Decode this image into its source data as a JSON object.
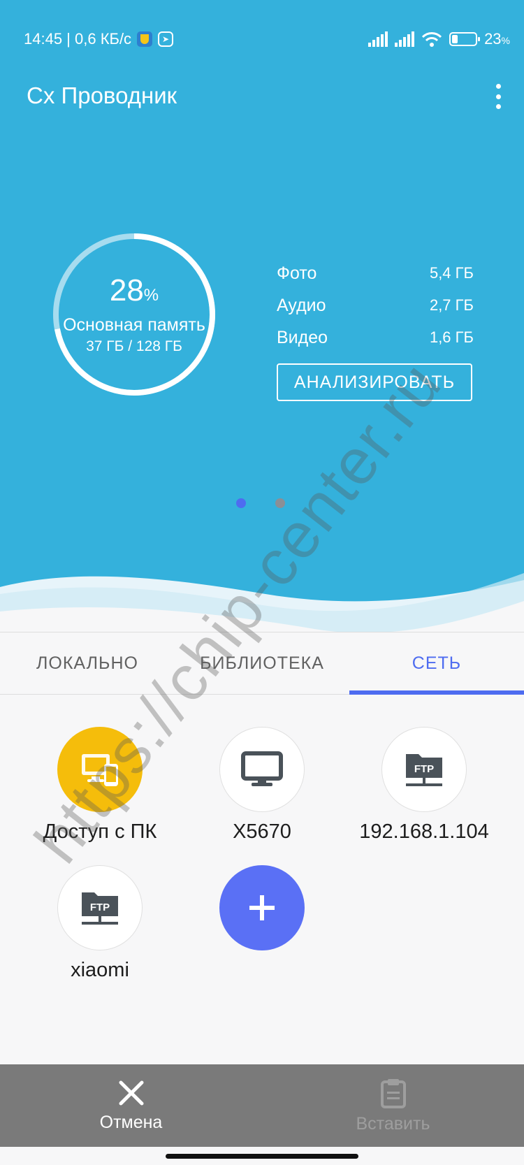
{
  "status_bar": {
    "time_speed": "14:45 | 0,6 КБ/с",
    "battery": "23",
    "battery_unit": "%"
  },
  "header": {
    "title": "Cx Проводник"
  },
  "storage": {
    "percent": "28",
    "percent_sign": "%",
    "percent_value": 0.28,
    "name": "Основная память",
    "size": "37 ГБ / 128 ГБ",
    "stats": [
      {
        "label": "Фото",
        "value": "5,4 ГБ"
      },
      {
        "label": "Аудио",
        "value": "2,7 ГБ"
      },
      {
        "label": "Видео",
        "value": "1,6 ГБ"
      }
    ],
    "analyze_label": "АНАЛИЗИРОВАТЬ"
  },
  "pager": {
    "active_color": "#4e6cf0",
    "inactive_color": "#8a8f96"
  },
  "tabs": [
    "ЛОКАЛЬНО",
    "БИБЛИОТЕКА",
    "СЕТЬ"
  ],
  "network_items": [
    {
      "label": "Доступ с ПК",
      "icon": "pc-access-icon"
    },
    {
      "label": "X5670",
      "icon": "monitor-icon"
    },
    {
      "label": "192.168.1.104",
      "icon": "ftp-folder-icon",
      "icon_text": "FTP"
    },
    {
      "label": "xiaomi",
      "icon": "ftp-folder-icon",
      "icon_text": "FTP"
    }
  ],
  "bottom_bar": {
    "cancel": "Отмена",
    "paste": "Вставить"
  },
  "watermark": "https://chip-center.ru",
  "colors": {
    "accent": "#4e6cf0",
    "hero": "#34b1dc",
    "pc_access": "#f5bd0b",
    "add_button": "#5a70f5"
  }
}
